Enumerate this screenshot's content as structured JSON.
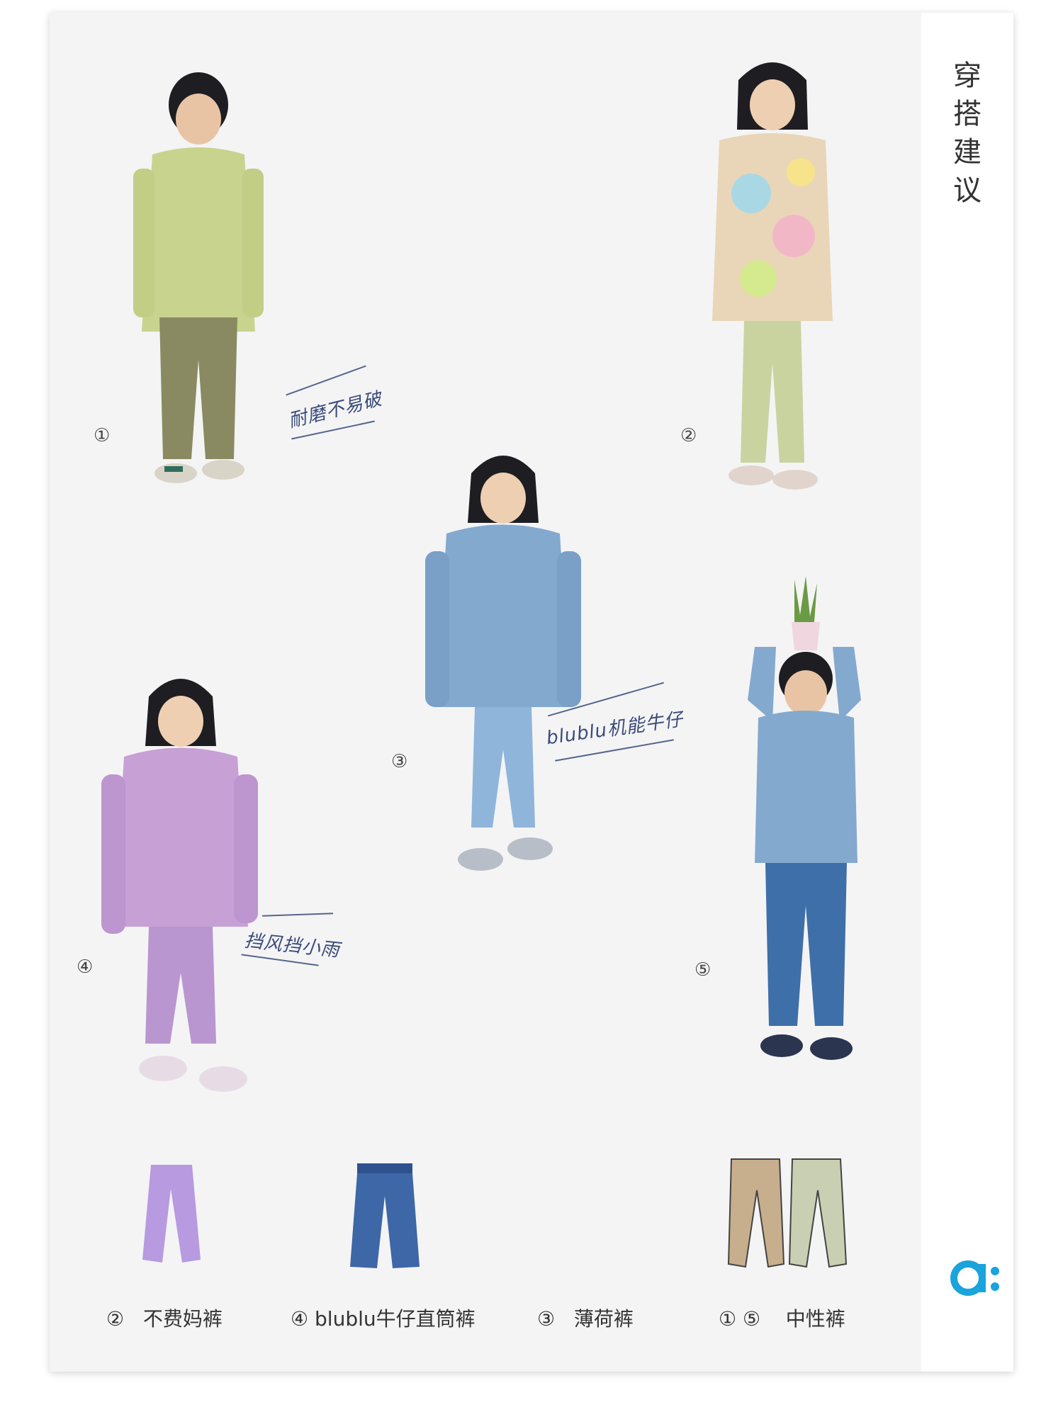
{
  "sidebar": {
    "title_chars": [
      "穿",
      "搭",
      "建",
      "议"
    ]
  },
  "outfits": [
    {
      "num": "①",
      "tag": "耐磨不易破"
    },
    {
      "num": "②"
    },
    {
      "num": "③",
      "tag": "blublu机能牛仔"
    },
    {
      "num": "④",
      "tag": "挡风挡小雨"
    },
    {
      "num": "⑤"
    }
  ],
  "products": [
    {
      "num": "②",
      "name": "不费妈裤"
    },
    {
      "num": "④",
      "name": "blublu牛仔直筒裤"
    },
    {
      "num": "③",
      "name": "薄荷裤"
    },
    {
      "num": "① ⑤",
      "name": "中性裤"
    }
  ],
  "colors": {
    "accent": "#1aa3dc",
    "tag_ink": "#3a4b7a",
    "panel_bg": "#f4f4f5"
  }
}
